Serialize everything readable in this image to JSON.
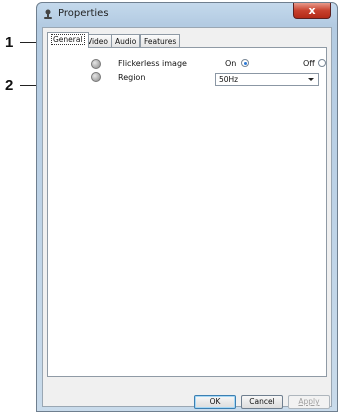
{
  "callouts": [
    {
      "number": "1"
    },
    {
      "number": "2"
    }
  ],
  "window": {
    "title": "Properties",
    "close_glyph": "x"
  },
  "tabs": [
    {
      "label": "General",
      "active": true
    },
    {
      "label": "Video",
      "active": false
    },
    {
      "label": "Audio",
      "active": false
    },
    {
      "label": "Features",
      "active": false
    }
  ],
  "general": {
    "flickerless": {
      "label": "Flickerless image",
      "on_label": "On",
      "off_label": "Off",
      "selected": "On",
      "icon": "circle-icon"
    },
    "region": {
      "label": "Region",
      "value": "50Hz",
      "icon": "circle-icon"
    }
  },
  "buttons": {
    "ok": "OK",
    "cancel": "Cancel",
    "apply": "Apply"
  }
}
